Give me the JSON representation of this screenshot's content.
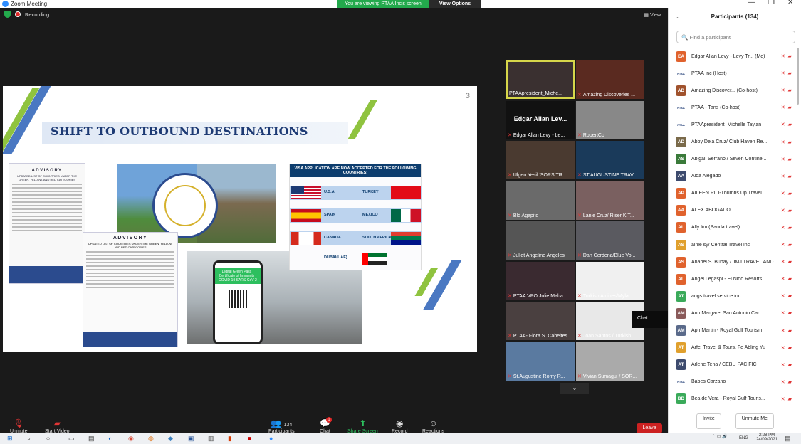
{
  "window": {
    "title": "Zoom Meeting",
    "viewing_banner": "You are viewing PTAA Inc's screen",
    "view_options": "View Options"
  },
  "meeting": {
    "recording_label": "Recording",
    "view_label": "View"
  },
  "slide": {
    "page_number": "3",
    "title": "SHIFT TO OUTBOUND DESTINATIONS",
    "advisory1_heading": "ADVISORY",
    "advisory1_sub": "UPDATED LIST OF COUNTRIES UNDER THE GREEN, YELLOW, AND RED CATEGORIES",
    "advisory2_heading": "ADVISORY",
    "advisory2_sub": "UPDATED LIST OF COUNTRIES UNDER THE GREEN, YELLOW AND RED CATEGORIES",
    "seal_text": "DEPARTMENT OF TOURISM · PHILIPPINES",
    "phone_text": "Digital Green Pass · Certificate of Immunity · COVID-19 SARS-CoV-2",
    "visa_heading": "VISA APPLICATION ARE NOW ACCEPTED FOR THE FOLLOWING COUNTRIES:",
    "visa_countries": [
      "U.S.A",
      "TURKEY",
      "SPAIN",
      "MEXICO",
      "CANADA",
      "SOUTH AFRICA",
      "DUBAI(UAE)"
    ]
  },
  "videos": [
    {
      "name": "PTAApresident_Miche...",
      "active": true,
      "muted": false
    },
    {
      "name": "Amazing Discoveries ...",
      "muted": true
    },
    {
      "name": "Edgar Allan Levy - Le...",
      "big_name": "Edgar Allan Lev...",
      "muted": true
    },
    {
      "name": "RobertCo",
      "muted": true
    },
    {
      "name": "Ulgen Yesil 'SORS TR...",
      "muted": true
    },
    {
      "name": "ST.AUGUSTINE TRAV...",
      "muted": true
    },
    {
      "name": "Bld Agapito",
      "muted": true
    },
    {
      "name": "Lanie Cruz/ Riser K T...",
      "muted": true
    },
    {
      "name": "Juliet Angeline Angeles",
      "muted": true
    },
    {
      "name": "Dan Cerdena/Blue Vo...",
      "muted": true
    },
    {
      "name": "PTAA VPO Julie Maba...",
      "muted": true
    },
    {
      "name": "Turkish Airlines/Myla...",
      "muted": true
    },
    {
      "name": "PTAA- Flora S. Cabeltes",
      "muted": true
    },
    {
      "name": "Joan Santos / Turkish...",
      "muted": true
    },
    {
      "name": "St.Augustine Romy R...",
      "muted": true
    },
    {
      "name": "Vivian Sumagui / SOR...",
      "muted": true
    }
  ],
  "tooltip": {
    "text": "Chat"
  },
  "toolbar": {
    "unmute": "Unmute",
    "start_video": "Start Video",
    "participants": "Participants",
    "participants_count": "134",
    "chat": "Chat",
    "chat_badge": "1",
    "share_screen": "Share Screen",
    "record": "Record",
    "reactions": "Reactions",
    "leave": "Leave"
  },
  "panel": {
    "title": "Participants (134)",
    "search_placeholder": "Find a participant",
    "participants": [
      {
        "initials": "EA",
        "name": "Edgar Allan Levy - Levy Tr... (Me)",
        "color": "#e0622d"
      },
      {
        "initials": "PTAA",
        "name": "PTAA Inc (Host)",
        "color": "#1d3a74"
      },
      {
        "initials": "AD",
        "name": "Amazing Discover... (Co-host)",
        "color": "#a0522d"
      },
      {
        "initials": "PTAA",
        "name": "PTAA - Tans (Co-host)",
        "color": "#1d3a74"
      },
      {
        "initials": "PTAA",
        "name": "PTAApresident_Michelle Taylan",
        "color": "#1d3a74"
      },
      {
        "initials": "AD",
        "name": "Abby Dela Cruz/ Club Haven Re...",
        "color": "#7a6a4a"
      },
      {
        "initials": "AS",
        "name": "Abigail Serrano / Seven Contine...",
        "color": "#3a7a3a"
      },
      {
        "initials": "AA",
        "name": "Aida Alegado",
        "color": "#3d4b6e"
      },
      {
        "initials": "AP",
        "name": "AILEEN PILI-Thumbs Up Travel",
        "color": "#e0622d"
      },
      {
        "initials": "AA",
        "name": "ALEX ABOGADO",
        "color": "#e0622d"
      },
      {
        "initials": "AL",
        "name": "Ally lim  (Panda travel)",
        "color": "#e0622d"
      },
      {
        "initials": "AS",
        "name": "alnie sy/ Central Travel inc",
        "color": "#e0a02d"
      },
      {
        "initials": "AS",
        "name": "Anabel S. Buhay / JMJ TRAVEL AND ...",
        "color": "#e0622d"
      },
      {
        "initials": "AL",
        "name": "Angel Legaspi - El Nido Resorts",
        "color": "#e0622d"
      },
      {
        "initials": "AT",
        "name": "angs travel service inc.",
        "color": "#3aaa5a"
      },
      {
        "initials": "AM",
        "name": "Ann Margaret San Antonio Car...",
        "color": "#8a5a5a"
      },
      {
        "initials": "AM",
        "name": "Aph Martin - Royal Gulf Tourism",
        "color": "#5a6a8a"
      },
      {
        "initials": "AT",
        "name": "Arfel Travel & Tours, Fe Abling Yu",
        "color": "#e0a02d"
      },
      {
        "initials": "AT",
        "name": "Arlene Tena / CEBU PACIFIC",
        "color": "#3d4b6e"
      },
      {
        "initials": "PTAA",
        "name": "Babes Carzano",
        "color": "#1d3a74"
      },
      {
        "initials": "BD",
        "name": "Bea de Vera - Royal Gulf Touris...",
        "color": "#3aaa5a"
      }
    ],
    "invite": "Invite",
    "unmute_me": "Unmute Me"
  },
  "taskbar": {
    "time": "2:28 PM",
    "date": "24/09/2021",
    "lang": "ENG"
  }
}
